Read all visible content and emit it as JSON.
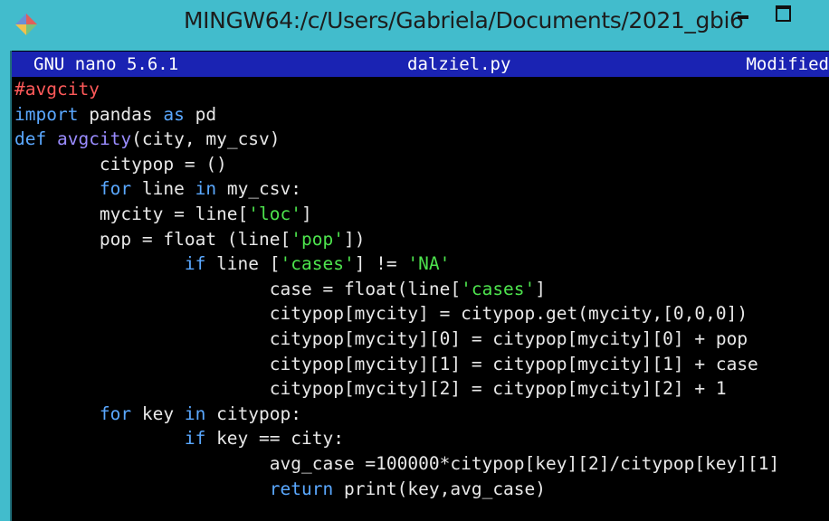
{
  "window": {
    "title": "MINGW64:/c/Users/Gabriela/Documents/2021_gbi6",
    "icon": "mingw-icon"
  },
  "nano": {
    "version": "GNU nano 5.6.1",
    "filename": "dalziel.py",
    "state": "Modified"
  },
  "colors": {
    "titlebar": "#42bccc",
    "statusbar": "#1a23b3",
    "comment": "#ff5a5a",
    "keyword": "#5aa8ff",
    "function": "#9a8cff",
    "string": "#4de34d",
    "text": "#e8e8e8"
  },
  "code_lines": [
    [
      {
        "t": "#avgcity",
        "k": "comment"
      }
    ],
    [
      {
        "t": "import",
        "k": "keyword"
      },
      {
        "t": " pandas ",
        "k": "text"
      },
      {
        "t": "as",
        "k": "keyword"
      },
      {
        "t": " pd",
        "k": "text"
      }
    ],
    [
      {
        "t": "def",
        "k": "keyword"
      },
      {
        "t": " ",
        "k": "text"
      },
      {
        "t": "avgcity",
        "k": "func"
      },
      {
        "t": "(city, my_csv)",
        "k": "text"
      }
    ],
    [
      {
        "t": "        citypop = ()",
        "k": "text"
      }
    ],
    [
      {
        "t": "        ",
        "k": "text"
      },
      {
        "t": "for",
        "k": "keyword"
      },
      {
        "t": " line ",
        "k": "text"
      },
      {
        "t": "in",
        "k": "keyword"
      },
      {
        "t": " my_csv:",
        "k": "text"
      }
    ],
    [
      {
        "t": "        mycity = line[",
        "k": "text"
      },
      {
        "t": "'loc'",
        "k": "string"
      },
      {
        "t": "]",
        "k": "text"
      }
    ],
    [
      {
        "t": "        pop = float (line[",
        "k": "text"
      },
      {
        "t": "'pop'",
        "k": "string"
      },
      {
        "t": "])",
        "k": "text"
      }
    ],
    [
      {
        "t": "                ",
        "k": "text"
      },
      {
        "t": "if",
        "k": "keyword"
      },
      {
        "t": " line [",
        "k": "text"
      },
      {
        "t": "'cases'",
        "k": "string"
      },
      {
        "t": "] != ",
        "k": "text"
      },
      {
        "t": "'NA'",
        "k": "string"
      }
    ],
    [
      {
        "t": "                        case = float(line[",
        "k": "text"
      },
      {
        "t": "'cases'",
        "k": "string"
      },
      {
        "t": "]",
        "k": "text"
      }
    ],
    [
      {
        "t": "                        citypop[mycity] = citypop.get(mycity,[0,0,0])",
        "k": "text"
      }
    ],
    [
      {
        "t": "                        citypop[mycity][0] = citypop[mycity][0] + pop",
        "k": "text"
      }
    ],
    [
      {
        "t": "                        citypop[mycity][1] = citypop[mycity][1] + case",
        "k": "text"
      }
    ],
    [
      {
        "t": "                        citypop[mycity][2] = citypop[mycity][2] + 1",
        "k": "text"
      }
    ],
    [
      {
        "t": "        ",
        "k": "text"
      },
      {
        "t": "for",
        "k": "keyword"
      },
      {
        "t": " key ",
        "k": "text"
      },
      {
        "t": "in",
        "k": "keyword"
      },
      {
        "t": " citypop:",
        "k": "text"
      }
    ],
    [
      {
        "t": "                ",
        "k": "text"
      },
      {
        "t": "if",
        "k": "keyword"
      },
      {
        "t": " key == city:",
        "k": "text"
      }
    ],
    [
      {
        "t": "                        avg_case =100000*citypop[key][2]/citypop[key][1]",
        "k": "text"
      }
    ],
    [
      {
        "t": "                        ",
        "k": "text"
      },
      {
        "t": "return",
        "k": "keyword"
      },
      {
        "t": " print(key,avg_case)",
        "k": "text"
      }
    ]
  ]
}
